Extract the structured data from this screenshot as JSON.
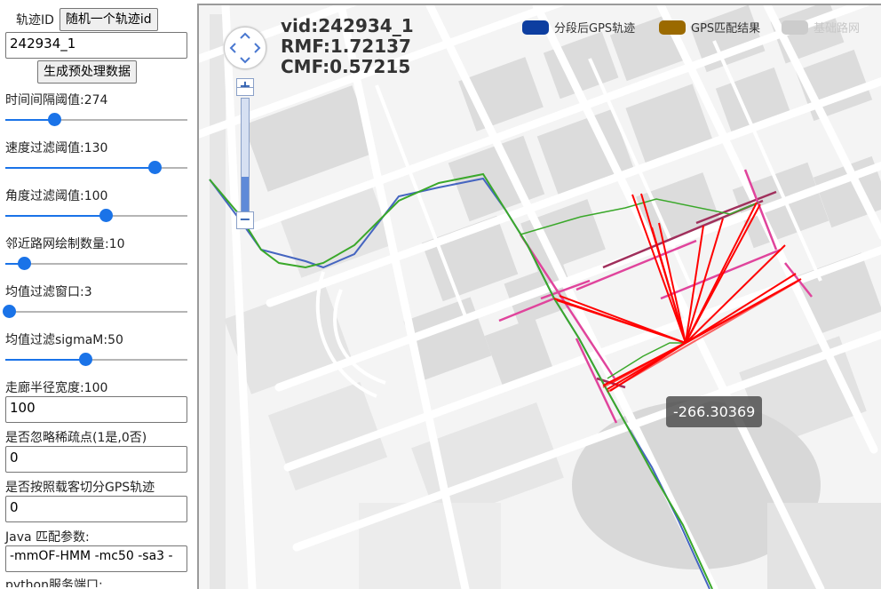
{
  "panel": {
    "traj_id_label": "轨迹ID",
    "random_button": "随机一个轨迹id",
    "traj_id_value": "242934_1",
    "gen_button": "生成预处理数据",
    "sliders": [
      {
        "label": "时间间隔阈值:274",
        "fraction": 0.27
      },
      {
        "label": "速度过滤阈值:130",
        "fraction": 0.82
      },
      {
        "label": "角度过滤阈值:100",
        "fraction": 0.55
      },
      {
        "label": "邻近路网绘制数量:10",
        "fraction": 0.1
      },
      {
        "label": "均值过滤窗口:3",
        "fraction": 0.02
      },
      {
        "label": "均值过滤sigmaM:50",
        "fraction": 0.44
      }
    ],
    "corridor_label": "走廊半径宽度:100",
    "corridor_value": "100",
    "ignore_sparse_label": "是否忽略稀疏点(1是,0否)",
    "ignore_sparse_value": "0",
    "split_label": "是否按照载客切分GPS轨迹",
    "split_value": "0",
    "java_label": "Java 匹配参数:",
    "java_value": "-mmOF-HMM -mc50 -sa3 -",
    "python_label": "python服务端口:"
  },
  "map": {
    "vid": "vid:242934_1",
    "rmf": "RMF:1.72137",
    "cmf": "CMF:0.57215",
    "legend": [
      {
        "name": "分段后GPS轨迹",
        "color": "#0d3ea0"
      },
      {
        "name": "GPS匹配结果",
        "color": "#9b6a00"
      },
      {
        "name": "基础路网",
        "color": "#cccccc"
      }
    ],
    "tooltip": "-266.30369",
    "zoom_level_fraction": 0.35,
    "colors": {
      "gps": "#4565c0",
      "match": "#3aa82a",
      "candidate": "#e0449c",
      "candidate_dark": "#a0305c",
      "transition": "#ff0000",
      "block": "#dcdcdc",
      "road": "#ffffff"
    }
  }
}
